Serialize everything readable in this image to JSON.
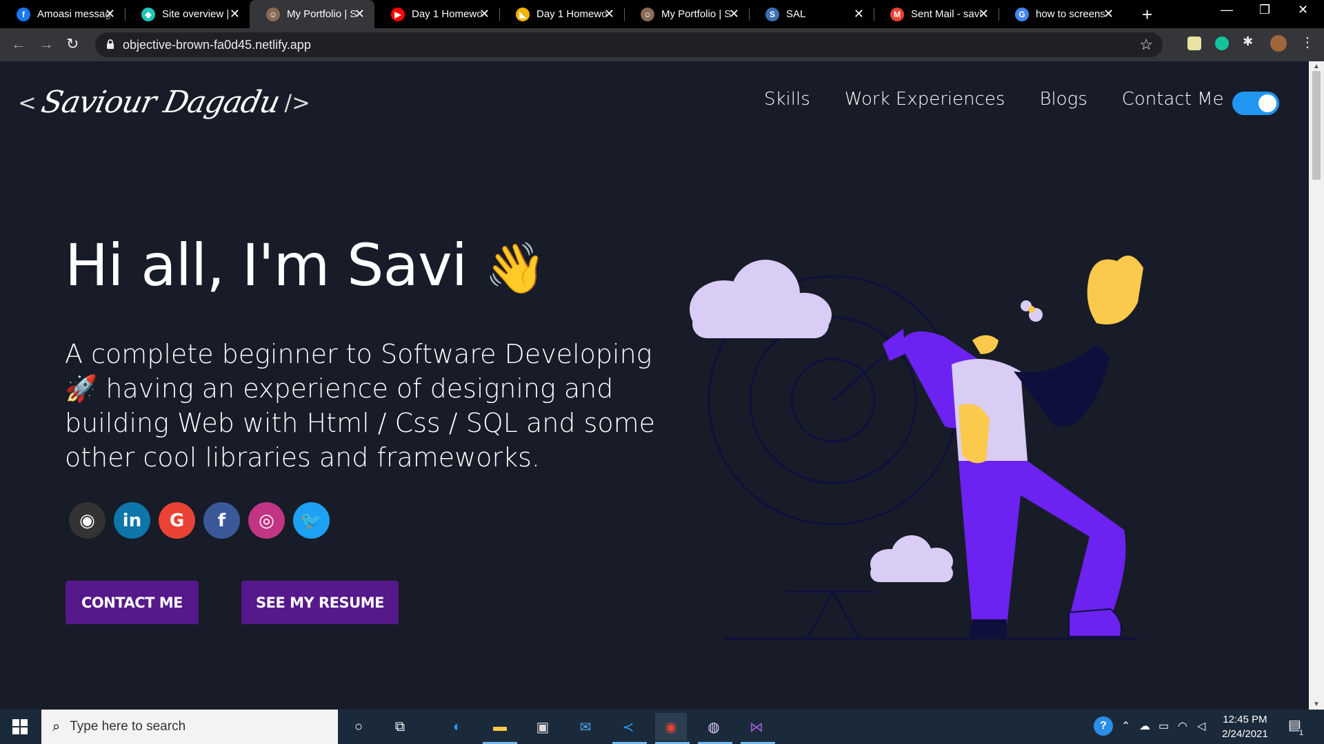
{
  "browser": {
    "tabs": [
      {
        "title": "Amoasi messag",
        "favicon": "facebook-icon",
        "color": "#1877f2",
        "glyph": "f"
      },
      {
        "title": "Site overview | ",
        "favicon": "netlify-icon",
        "color": "#20c6b7",
        "glyph": "◆"
      },
      {
        "title": "My Portfolio | S",
        "favicon": "avatar-icon",
        "color": "#8a6a55",
        "glyph": "☺",
        "active": true
      },
      {
        "title": "Day 1 Homewo",
        "favicon": "youtube-icon",
        "color": "#ff0000",
        "glyph": "▶"
      },
      {
        "title": "Day 1 Homewo",
        "favicon": "google-classroom-icon",
        "color": "#f4b400",
        "glyph": "◣"
      },
      {
        "title": "My Portfolio | S",
        "favicon": "avatar-icon",
        "color": "#8a6a55",
        "glyph": "☺"
      },
      {
        "title": "SAL",
        "favicon": "sal-icon",
        "color": "#3b6fb6",
        "glyph": "S"
      },
      {
        "title": "Sent Mail - savi",
        "favicon": "gmail-icon",
        "color": "#ea4335",
        "glyph": "M"
      },
      {
        "title": "how to screens",
        "favicon": "google-icon",
        "color": "#4285f4",
        "glyph": "G"
      }
    ],
    "new_tab": "+",
    "window_controls": {
      "minimize": "—",
      "restore": "❐",
      "close": "✕"
    },
    "url": "objective-brown-fa0d45.netlify.app"
  },
  "site": {
    "logo": {
      "open": "<",
      "signature": "Saviour Dagadu",
      "close": "/>"
    },
    "nav": [
      "Skills",
      "Work Experiences",
      "Blogs",
      "Contact Me"
    ],
    "dark_mode_toggle": "on",
    "greeting": "Hi all, I'm Savi",
    "greeting_emoji": "👋",
    "subtitle": "A complete beginner to Software Developing 🚀 having an experience of designing and building Web with Html / Css / SQL and some other cool libraries and frameworks.",
    "socials": [
      {
        "name": "github-icon",
        "color": "#333333",
        "glyph": "◉"
      },
      {
        "name": "linkedin-icon",
        "color": "#0e76a8",
        "glyph": "in"
      },
      {
        "name": "google-icon",
        "color": "#ea4335",
        "glyph": "G"
      },
      {
        "name": "facebook-icon",
        "color": "#3b5998",
        "glyph": "f"
      },
      {
        "name": "instagram-icon",
        "color": "#c13584",
        "glyph": "◎"
      },
      {
        "name": "twitter-icon",
        "color": "#1da1f2",
        "glyph": "🐦"
      }
    ],
    "buttons": {
      "contact": "CONTACT ME",
      "resume": "SEE MY RESUME"
    },
    "accent": "#55198b",
    "illustration_colors": {
      "purple": "#6c22f0",
      "lavender": "#d9cdf6",
      "yellow": "#fbc94b",
      "navy": "#0f0f3d"
    }
  },
  "taskbar": {
    "search_placeholder": "Type here to search",
    "time": "12:45 PM",
    "date": "2/24/2021",
    "notification_count": "1"
  }
}
